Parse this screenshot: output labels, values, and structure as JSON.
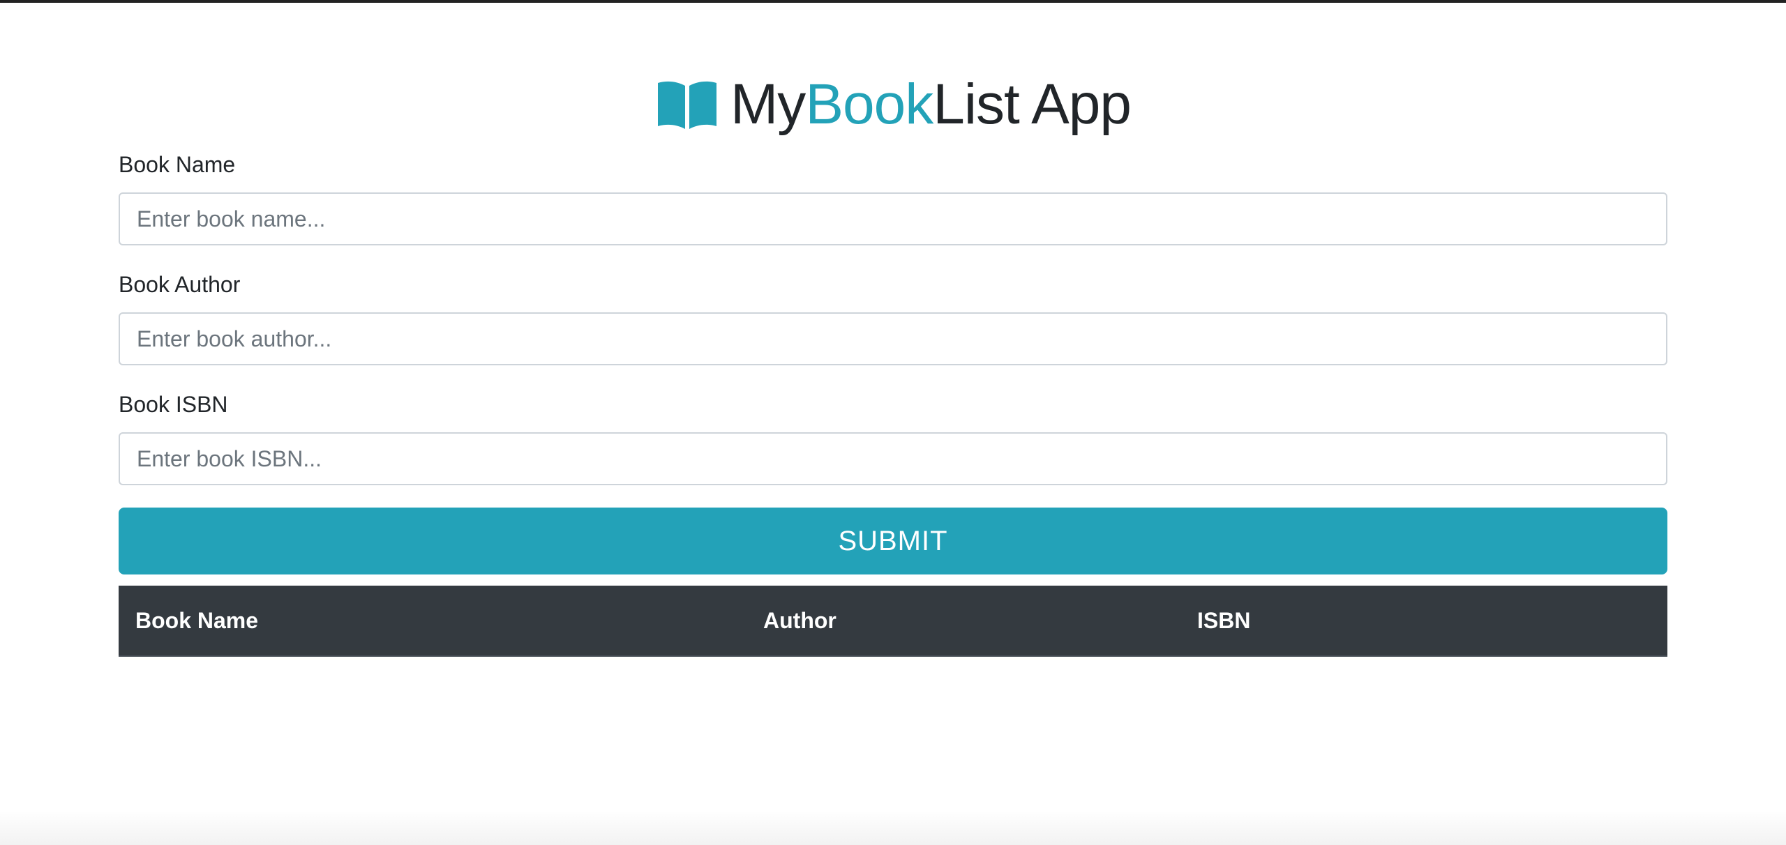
{
  "app": {
    "title_parts": {
      "prefix": "My",
      "accent": "Book",
      "suffix": "List App"
    },
    "logo_icon": "open-book-icon",
    "accent_color": "#23a2b8",
    "header_dark_color": "#343a40"
  },
  "form": {
    "book_name": {
      "label": "Book Name",
      "placeholder": "Enter book name...",
      "value": ""
    },
    "book_author": {
      "label": "Book Author",
      "placeholder": "Enter book author...",
      "value": ""
    },
    "book_isbn": {
      "label": "Book ISBN",
      "placeholder": "Enter book ISBN...",
      "value": ""
    },
    "submit_label": "SUBMIT"
  },
  "table": {
    "columns": [
      "Book Name",
      "Author",
      "ISBN"
    ],
    "rows": []
  }
}
